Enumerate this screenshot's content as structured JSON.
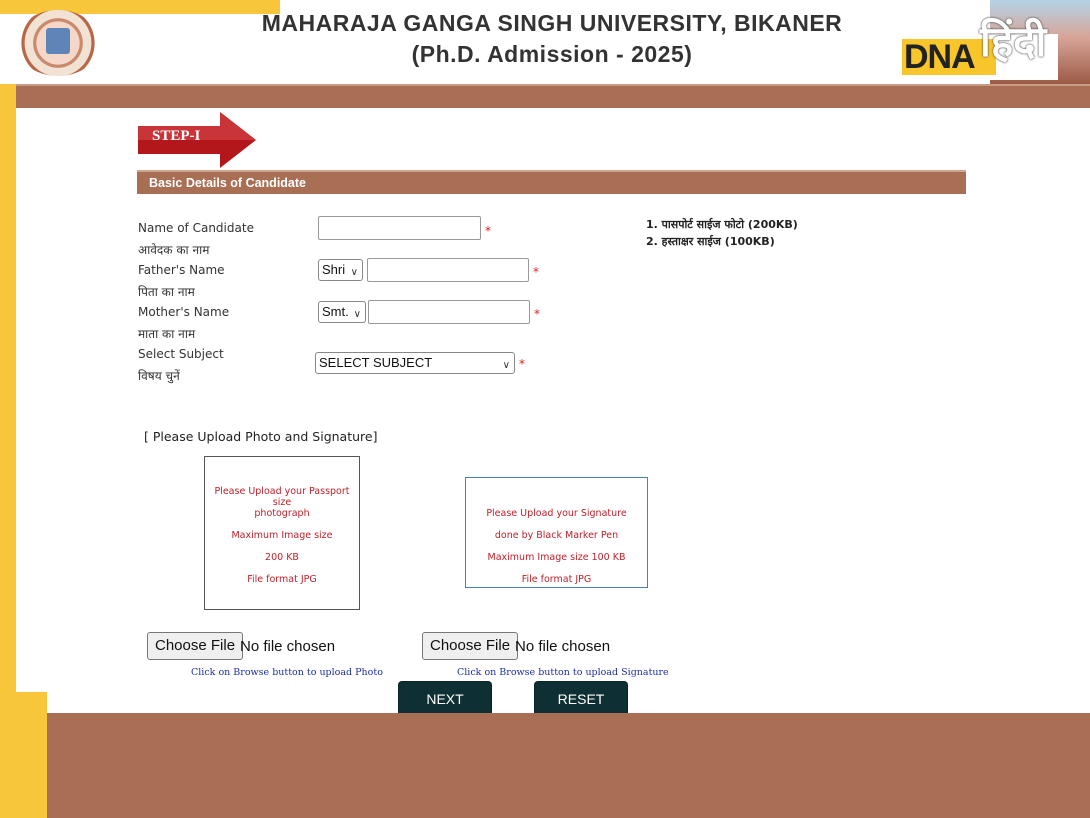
{
  "header": {
    "title_line1": "MAHARAJA GANGA SINGH UNIVERSITY, BIKANER",
    "title_line2": "(Ph.D. Admission - 2025)",
    "watermark_brand": "DNA",
    "watermark_hindi": "हिंदी"
  },
  "step": {
    "label": "STEP-I"
  },
  "section": {
    "title": "Basic Details of Candidate"
  },
  "form": {
    "candidate_name": {
      "label_en": "Name of Candidate",
      "label_hi": "आवेदक का नाम",
      "value": "",
      "required_mark": "*"
    },
    "father_name": {
      "label_en": "Father's Name",
      "label_hi": "पिता का नाम",
      "prefix": "Shri",
      "value": "",
      "required_mark": "*"
    },
    "mother_name": {
      "label_en": "Mother's Name",
      "label_hi": "माता का नाम",
      "prefix": "Smt.",
      "value": "",
      "required_mark": "*"
    },
    "subject": {
      "label_en": "Select Subject",
      "label_hi": "विषय चुनें",
      "selected": "SELECT SUBJECT",
      "required_mark": "*"
    }
  },
  "notes": [
    "1. पासपोर्ट साईज फोटो (200KB)",
    "2. हस्ताक्षर साईज (100KB)"
  ],
  "upload": {
    "heading": "[ Please Upload Photo and Signature]",
    "photo_box": [
      "Please Upload your Passport size",
      "photograph",
      "Maximum Image size",
      "200 KB",
      "File format JPG"
    ],
    "signature_box": [
      "Please Upload your Signature",
      "done by Black Marker Pen",
      "Maximum Image size 100 KB",
      "File format JPG"
    ],
    "photo_button": "Choose File",
    "photo_status": "No file chosen",
    "photo_hint": "Click on Browse button to upload Photo",
    "signature_button": "Choose File",
    "signature_status": "No file chosen",
    "signature_hint": "Click on Browse button to upload Signature"
  },
  "actions": {
    "next": "NEXT",
    "reset": "RESET"
  },
  "colors": {
    "brown": "#a86f54",
    "yellow": "#f7c63a",
    "button_dark": "#0e2f33",
    "arrow_red": "#b3161b",
    "hint_blue": "#1f2fa0"
  },
  "icons": {
    "select_chevron": "chevron-down-icon"
  }
}
